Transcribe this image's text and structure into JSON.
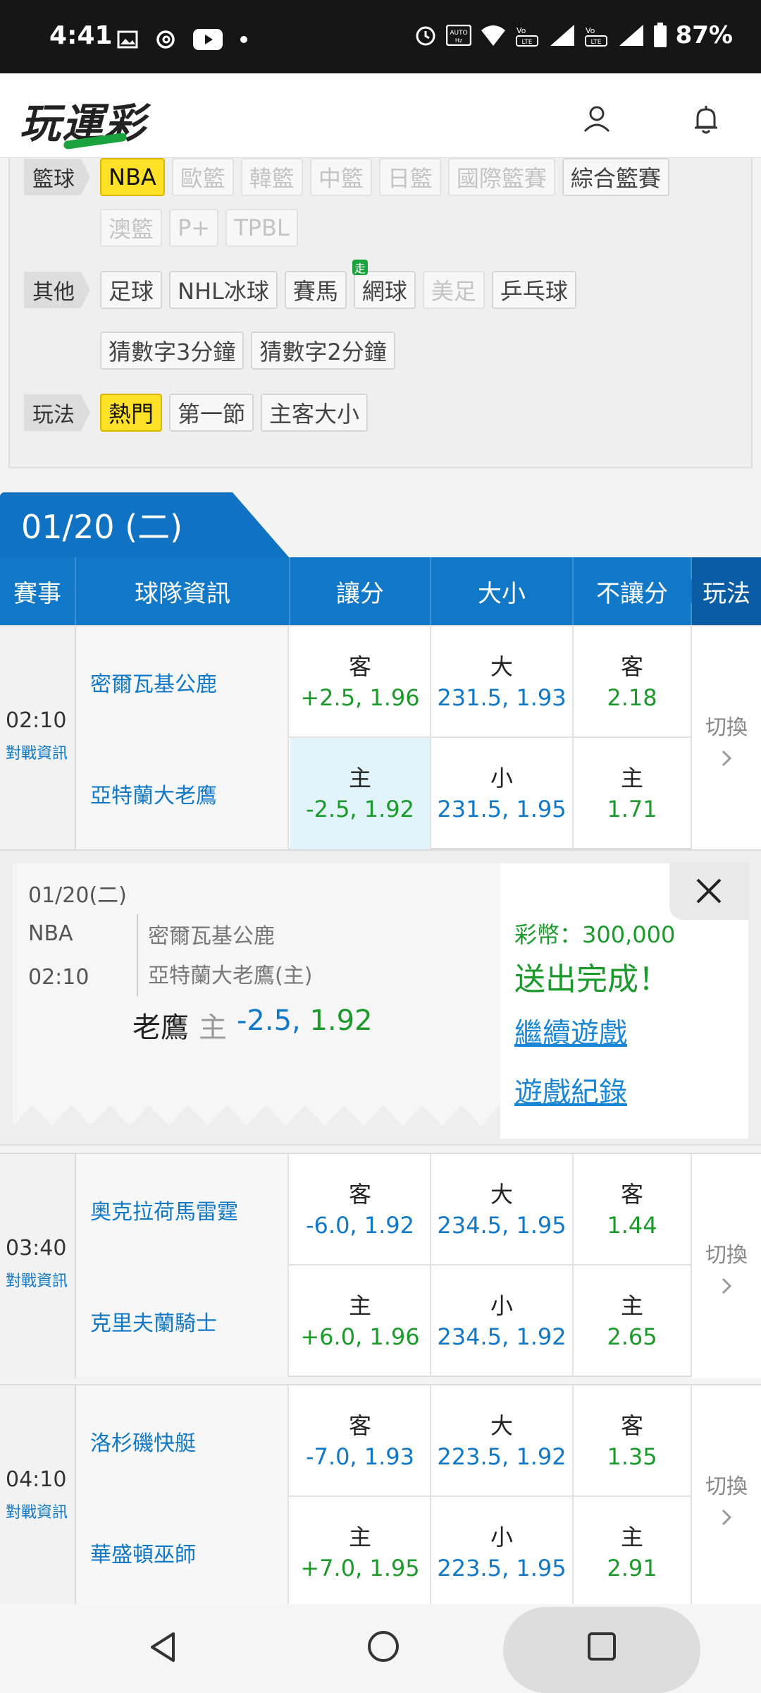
{
  "status_bar": {
    "time": "4:41",
    "battery": "87%",
    "left_icons": [
      "gallery-icon",
      "threads-icon",
      "youtube-icon",
      "dot-icon"
    ],
    "right_icons": [
      "alarm-icon",
      "auto-hz-icon",
      "wifi-icon",
      "volte-lte-icon",
      "signal-icon",
      "battery-icon"
    ]
  },
  "header": {
    "logo": "玩運彩",
    "user_icon": "user-icon",
    "bell_icon": "bell-icon"
  },
  "filters": {
    "basketball": {
      "label": "籃球",
      "chips_row1": [
        {
          "text": "NBA",
          "state": "active"
        },
        {
          "text": "歐籃",
          "state": "dim"
        },
        {
          "text": "韓籃",
          "state": "dim"
        },
        {
          "text": "中籃",
          "state": "dim"
        },
        {
          "text": "日籃",
          "state": "dim"
        },
        {
          "text": "國際籃賽",
          "state": "dim"
        },
        {
          "text": "綜合籃賽",
          "state": "normal"
        }
      ],
      "chips_row2": [
        {
          "text": "澳籃",
          "state": "dim"
        },
        {
          "text": "P+",
          "state": "dim"
        },
        {
          "text": "TPBL",
          "state": "dim"
        }
      ]
    },
    "other": {
      "label": "其他",
      "chips_row1": [
        {
          "text": "足球",
          "state": "normal"
        },
        {
          "text": "NHL冰球",
          "state": "normal"
        },
        {
          "text": "賽馬",
          "state": "normal"
        },
        {
          "text": "網球",
          "state": "normal",
          "badge": "走"
        },
        {
          "text": "美足",
          "state": "dim"
        },
        {
          "text": "乒乓球",
          "state": "normal"
        }
      ],
      "chips_row2": [
        {
          "text": "猜數字3分鐘",
          "state": "normal"
        },
        {
          "text": "猜數字2分鐘",
          "state": "normal"
        }
      ]
    },
    "play": {
      "label": "玩法",
      "chips": [
        {
          "text": "熱門",
          "state": "active"
        },
        {
          "text": "第一節",
          "state": "normal"
        },
        {
          "text": "主客大小",
          "state": "normal"
        }
      ]
    }
  },
  "date_tab": "01/20 (二)",
  "table_header": {
    "event": "賽事",
    "team_info": "球隊資訊",
    "spread": "讓分",
    "total": "大小",
    "moneyline": "不讓分",
    "play": "玩法"
  },
  "games": [
    {
      "time": "02:10",
      "info_link": "對戰資訊",
      "switch": "切換",
      "away": {
        "team": "密爾瓦基公鹿",
        "spread_label": "客",
        "spread": "+2.5, 1.96",
        "total_label": "大",
        "total": "231.5, 1.93",
        "ml_label": "客",
        "ml": "2.18"
      },
      "home": {
        "team": "亞特蘭大老鷹",
        "spread_label": "主",
        "spread": "-2.5, 1.92",
        "total_label": "小",
        "total": "231.5, 1.95",
        "ml_label": "主",
        "ml": "1.71"
      }
    },
    {
      "time": "03:40",
      "info_link": "對戰資訊",
      "switch": "切換",
      "away": {
        "team": "奧克拉荷馬雷霆",
        "spread_label": "客",
        "spread": "-6.0, 1.92",
        "total_label": "大",
        "total": "234.5, 1.95",
        "ml_label": "客",
        "ml": "1.44"
      },
      "home": {
        "team": "克里夫蘭騎士",
        "spread_label": "主",
        "spread": "+6.0, 1.96",
        "total_label": "小",
        "total": "234.5, 1.92",
        "ml_label": "主",
        "ml": "2.65"
      }
    },
    {
      "time": "04:10",
      "info_link": "對戰資訊",
      "switch": "切換",
      "away": {
        "team": "洛杉磯快艇",
        "spread_label": "客",
        "spread": "-7.0, 1.93",
        "total_label": "大",
        "total": "223.5, 1.92",
        "ml_label": "客",
        "ml": "1.35"
      },
      "home": {
        "team": "華盛頓巫師",
        "spread_label": "主",
        "spread": "+7.0, 1.95",
        "total_label": "小",
        "total": "223.5, 1.95",
        "ml_label": "主",
        "ml": "2.91"
      }
    }
  ],
  "confirmation": {
    "date": "01/20(二)",
    "league": "NBA",
    "time": "02:10",
    "team1": "密爾瓦基公鹿",
    "team2": "亞特蘭大老鷹(主)",
    "pick_team": "老鷹",
    "pick_side": "主",
    "pick_line": "-2.5,",
    "pick_odds": "1.92",
    "balance": "彩幣：300,000",
    "status": "送出完成！",
    "continue_link": "繼續遊戲",
    "history_link": "遊戲紀錄"
  },
  "colors": {
    "brand_blue": "#1078c6",
    "odds_green": "#1b9a2b",
    "active_yellow": "#ffe227",
    "selected_cell": "#e1f4fb"
  }
}
